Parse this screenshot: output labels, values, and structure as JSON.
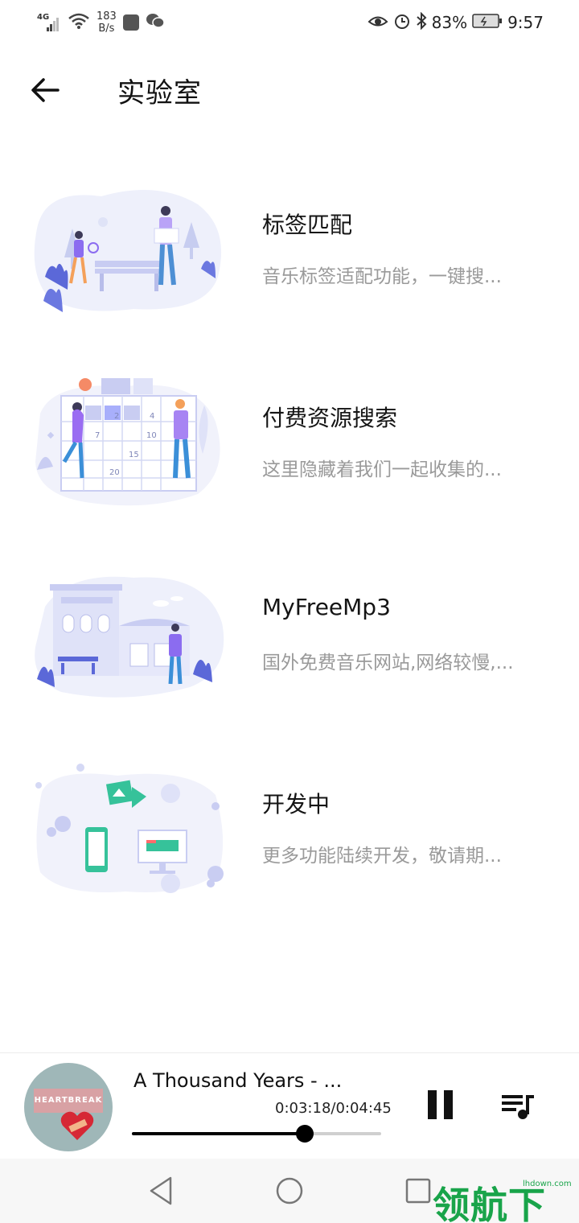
{
  "status_bar": {
    "network": "4G",
    "speed_value": "183",
    "speed_unit": "B/s",
    "battery": "83%",
    "time": "9:57"
  },
  "header": {
    "title": "实验室"
  },
  "items": [
    {
      "title": "标签匹配",
      "description": "音乐标签适配功能，一键搜..."
    },
    {
      "title": "付费资源搜索",
      "description": "这里隐藏着我们一起收集的..."
    },
    {
      "title": "MyFreeMp3",
      "description": "国外免费音乐网站,网络较慢,..."
    },
    {
      "title": "开发中",
      "description": "更多功能陆续开发，敬请期..."
    }
  ],
  "illustration_numbers": [
    "2",
    "4",
    "7",
    "10",
    "15",
    "20"
  ],
  "player": {
    "song_title": "A Thousand Years - ...",
    "time": "0:03:18/0:04:45",
    "progress_fraction": 0.695,
    "album_label": "HEARTBREAK"
  },
  "watermark": {
    "text": "领航下载",
    "site": "lhdown.com"
  },
  "colors": {
    "accent_purple": "#8b6cf0",
    "illus_bg": "#eef0fb",
    "desc_gray": "#9a9a9a",
    "watermark_green": "#19a44a"
  }
}
